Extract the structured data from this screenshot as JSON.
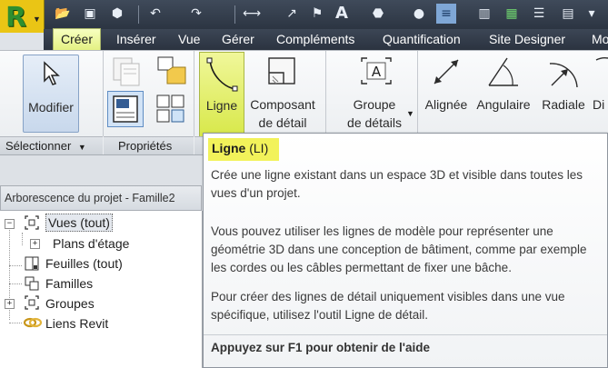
{
  "app": {
    "logo_letter": "R"
  },
  "tabs": [
    "Créer",
    "Insérer",
    "Vue",
    "Gérer",
    "Compléments",
    "Quantification",
    "Site Designer",
    "Mo"
  ],
  "ribbon": {
    "modifier_label": "Modifier",
    "ligne_label": "Ligne",
    "composant_line1": "Composant",
    "composant_line2": "de détail",
    "groupe_line1": "Groupe",
    "groupe_line2": "de détails",
    "alignee_label": "Alignée",
    "angulaire_label": "Angulaire",
    "radiale_label": "Radiale",
    "di_label": "Di"
  },
  "panels": {
    "selectionner": "Sélectionner",
    "proprietes": "Propriétés"
  },
  "project_browser": {
    "title": "Arborescence du projet - Famille2",
    "items": [
      "Vues (tout)",
      "Plans d'étage",
      "Feuilles (tout)",
      "Familles",
      "Groupes",
      "Liens Revit"
    ]
  },
  "tooltip": {
    "title": "Ligne",
    "shortcut": "(LI)",
    "p1": "Crée une ligne existant dans un espace 3D et visible dans toutes les vues d'un projet.",
    "p2": "Vous pouvez utiliser les lignes de modèle pour représenter une géométrie 3D dans une conception de bâtiment, comme par exemple les cordes ou les câbles permettant de fixer une bâche.",
    "p3": "Pour créer des lignes de détail uniquement visibles dans une vue spécifique, utilisez l'outil Ligne de détail.",
    "footer": "Appuyez sur F1 pour obtenir de l'aide"
  },
  "colors": {
    "highlight": "#e8f06a",
    "tooltip_title_bg": "#f2f25a",
    "app_button": "#eac515"
  }
}
